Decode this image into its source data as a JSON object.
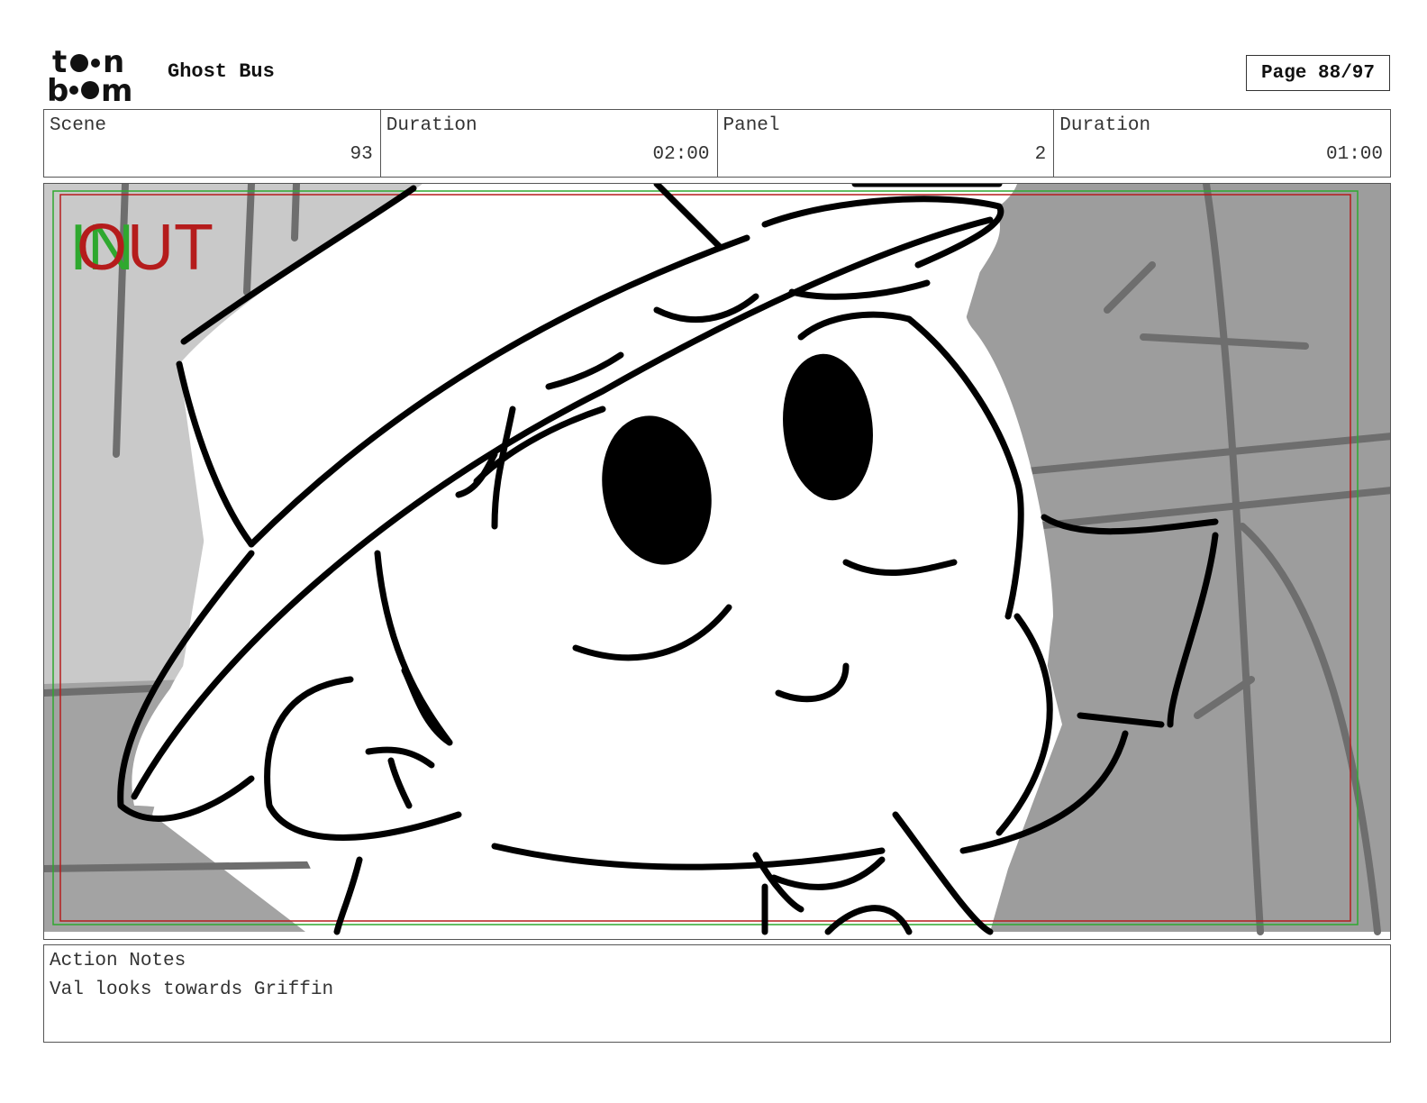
{
  "header": {
    "logo_text": "toon boom",
    "project_title": "Ghost Bus",
    "page_label": "Page 88/97"
  },
  "info_bar": {
    "scene_label": "Scene",
    "scene_value": "93",
    "scene_duration_label": "Duration",
    "scene_duration_value": "02:00",
    "panel_label": "Panel",
    "panel_value": "2",
    "panel_duration_label": "Duration",
    "panel_duration_value": "01:00"
  },
  "panel": {
    "in_marker": "IN",
    "out_marker": "OUT",
    "in_color": "#2fa82f",
    "out_color": "#b51c1c"
  },
  "notes": {
    "label": "Action Notes",
    "text": "Val looks towards Griffin"
  }
}
